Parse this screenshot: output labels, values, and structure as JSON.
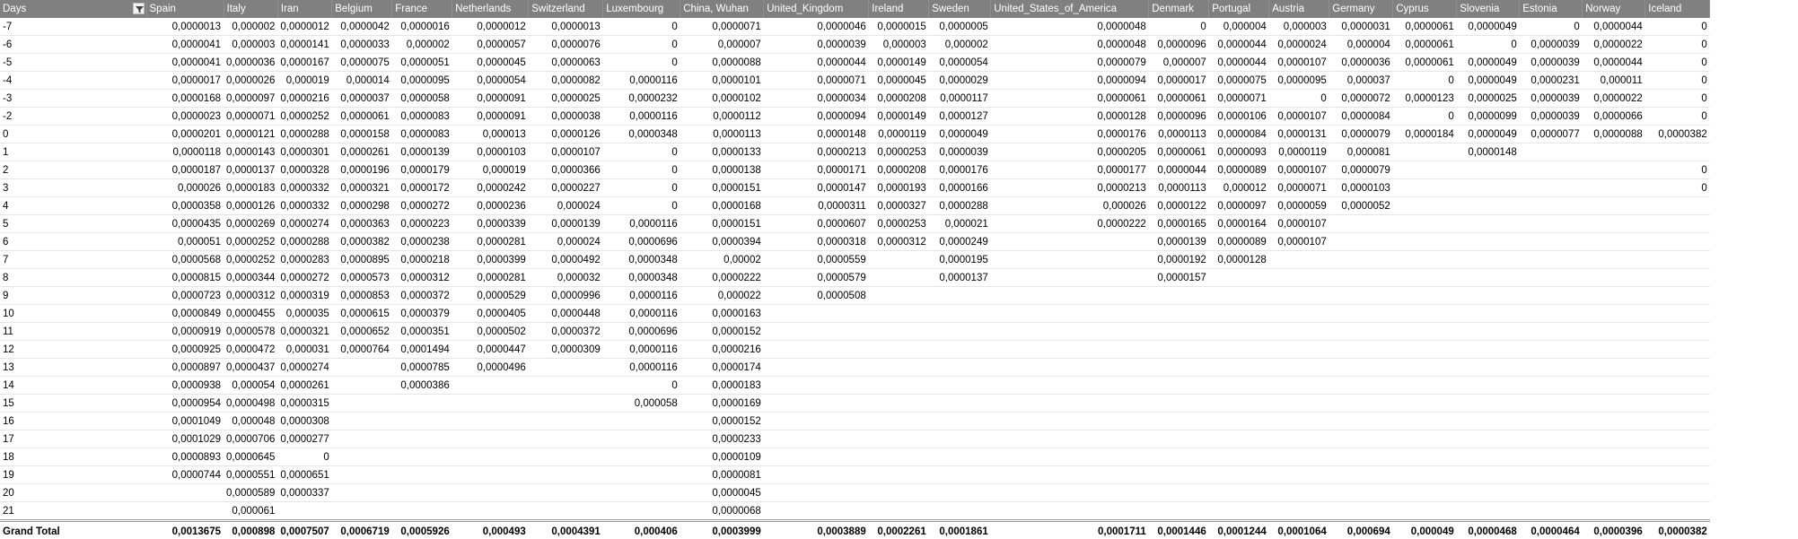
{
  "grid": {
    "row_label_header": "Days",
    "columns": [
      "Spain",
      "Italy",
      "Iran",
      "Belgium",
      "France",
      "Netherlands",
      "Switzerland",
      "Luxembourg",
      "China, Wuhan",
      "United_Kingdom",
      "Ireland",
      "Sweden",
      "United_States_of_America",
      "Denmark",
      "Portugal",
      "Austria",
      "Germany",
      "Cyprus",
      "Slovenia",
      "Estonia",
      "Norway",
      "Iceland"
    ],
    "rows": [
      {
        "day": "-7",
        "v": [
          "0,0000013",
          "0,000002",
          "0,0000012",
          "0,0000042",
          "0,0000016",
          "0,0000012",
          "0,0000013",
          "0",
          "0,0000071",
          "0,0000046",
          "0,0000015",
          "0,0000005",
          "0,0000048",
          "0",
          "0,000004",
          "0,000003",
          "0,0000031",
          "0,0000061",
          "0,0000049",
          "0",
          "0,0000044",
          "0"
        ]
      },
      {
        "day": "-6",
        "v": [
          "0,0000041",
          "0,000003",
          "0,0000141",
          "0,0000033",
          "0,000002",
          "0,0000057",
          "0,0000076",
          "0",
          "0,000007",
          "0,0000039",
          "0,000003",
          "0,000002",
          "0,0000048",
          "0,0000096",
          "0,0000044",
          "0,0000024",
          "0,000004",
          "0,0000061",
          "0",
          "0,0000039",
          "0,0000022",
          "0"
        ]
      },
      {
        "day": "-5",
        "v": [
          "0,0000041",
          "0,0000036",
          "0,0000167",
          "0,0000075",
          "0,0000051",
          "0,0000045",
          "0,0000063",
          "0",
          "0,0000088",
          "0,0000044",
          "0,0000149",
          "0,0000054",
          "0,0000079",
          "0,000007",
          "0,0000044",
          "0,0000107",
          "0,0000036",
          "0,0000061",
          "0,0000049",
          "0,0000039",
          "0,0000044",
          "0"
        ]
      },
      {
        "day": "-4",
        "v": [
          "0,0000017",
          "0,0000026",
          "0,000019",
          "0,000014",
          "0,0000095",
          "0,0000054",
          "0,0000082",
          "0,0000116",
          "0,0000101",
          "0,0000071",
          "0,0000045",
          "0,0000029",
          "0,0000094",
          "0,0000017",
          "0,0000075",
          "0,0000095",
          "0,000037",
          "0",
          "0,0000049",
          "0,0000231",
          "0,000011",
          "0"
        ]
      },
      {
        "day": "-3",
        "v": [
          "0,0000168",
          "0,0000097",
          "0,0000216",
          "0,0000037",
          "0,0000058",
          "0,0000091",
          "0,0000025",
          "0,0000232",
          "0,0000102",
          "0,0000034",
          "0,0000208",
          "0,0000117",
          "0,0000061",
          "0,0000061",
          "0,0000071",
          "0",
          "0,0000072",
          "0,0000123",
          "0,0000025",
          "0,0000039",
          "0,0000022",
          "0"
        ]
      },
      {
        "day": "-2",
        "v": [
          "0,0000023",
          "0,0000071",
          "0,0000252",
          "0,0000061",
          "0,0000083",
          "0,0000091",
          "0,0000038",
          "0,0000116",
          "0,0000112",
          "0,0000094",
          "0,0000149",
          "0,0000127",
          "0,0000128",
          "0,0000096",
          "0,0000106",
          "0,0000107",
          "0,0000084",
          "0",
          "0,0000099",
          "0,0000039",
          "0,0000066",
          "0"
        ]
      },
      {
        "day": "0",
        "v": [
          "0,0000201",
          "0,0000121",
          "0,0000288",
          "0,0000158",
          "0,0000083",
          "0,000013",
          "0,0000126",
          "0,0000348",
          "0,0000113",
          "0,0000148",
          "0,0000119",
          "0,0000049",
          "0,0000176",
          "0,0000113",
          "0,0000084",
          "0,0000131",
          "0,0000079",
          "0,0000184",
          "0,0000049",
          "0,0000077",
          "0,0000088",
          "0,0000382"
        ]
      },
      {
        "day": "1",
        "v": [
          "0,0000118",
          "0,0000143",
          "0,0000301",
          "0,0000261",
          "0,0000139",
          "0,0000103",
          "0,0000107",
          "0",
          "0,0000133",
          "0,0000213",
          "0,0000253",
          "0,0000039",
          "0,0000205",
          "0,0000061",
          "0,0000093",
          "0,0000119",
          "0,000081",
          "",
          "0,0000148",
          "",
          "",
          ""
        ]
      },
      {
        "day": "2",
        "v": [
          "0,0000187",
          "0,0000137",
          "0,0000328",
          "0,0000196",
          "0,0000179",
          "0,000019",
          "0,0000366",
          "0",
          "0,0000138",
          "0,0000171",
          "0,0000208",
          "0,0000176",
          "0,0000177",
          "0,0000044",
          "0,0000089",
          "0,0000107",
          "0,0000079",
          "",
          "",
          "",
          "",
          "0"
        ]
      },
      {
        "day": "3",
        "v": [
          "0,000026",
          "0,0000183",
          "0,0000332",
          "0,0000321",
          "0,0000172",
          "0,0000242",
          "0,0000227",
          "0",
          "0,0000151",
          "0,0000147",
          "0,0000193",
          "0,0000166",
          "0,0000213",
          "0,0000113",
          "0,000012",
          "0,0000071",
          "0,0000103",
          "",
          "",
          "",
          "",
          "0"
        ]
      },
      {
        "day": "4",
        "v": [
          "0,0000358",
          "0,0000126",
          "0,0000332",
          "0,0000298",
          "0,0000272",
          "0,0000236",
          "0,000024",
          "0",
          "0,0000168",
          "0,0000311",
          "0,0000327",
          "0,0000288",
          "0,000026",
          "0,0000122",
          "0,0000097",
          "0,0000059",
          "0,0000052",
          "",
          "",
          "",
          "",
          ""
        ]
      },
      {
        "day": "5",
        "v": [
          "0,0000435",
          "0,0000269",
          "0,0000274",
          "0,0000363",
          "0,0000223",
          "0,0000339",
          "0,0000139",
          "0,0000116",
          "0,0000151",
          "0,0000607",
          "0,0000253",
          "0,000021",
          "0,0000222",
          "0,0000165",
          "0,0000164",
          "0,0000107",
          "",
          "",
          "",
          "",
          "",
          ""
        ]
      },
      {
        "day": "6",
        "v": [
          "0,000051",
          "0,0000252",
          "0,0000288",
          "0,0000382",
          "0,0000238",
          "0,0000281",
          "0,000024",
          "0,0000696",
          "0,0000394",
          "0,0000318",
          "0,0000312",
          "0,0000249",
          "",
          "0,0000139",
          "0,0000089",
          "0,0000107",
          "",
          "",
          "",
          "",
          "",
          ""
        ]
      },
      {
        "day": "7",
        "v": [
          "0,0000568",
          "0,0000252",
          "0,0000283",
          "0,0000895",
          "0,0000218",
          "0,0000399",
          "0,0000492",
          "0,0000348",
          "0,00002",
          "0,0000559",
          "",
          "0,0000195",
          "",
          "0,0000192",
          "0,0000128",
          "",
          "",
          "",
          "",
          "",
          "",
          ""
        ]
      },
      {
        "day": "8",
        "v": [
          "0,0000815",
          "0,0000344",
          "0,0000272",
          "0,0000573",
          "0,0000312",
          "0,0000281",
          "0,000032",
          "0,0000348",
          "0,0000222",
          "0,0000579",
          "",
          "0,0000137",
          "",
          "0,0000157",
          "",
          "",
          "",
          "",
          "",
          "",
          "",
          ""
        ]
      },
      {
        "day": "9",
        "v": [
          "0,0000723",
          "0,0000312",
          "0,0000319",
          "0,0000853",
          "0,0000372",
          "0,0000529",
          "0,0000996",
          "0,0000116",
          "0,000022",
          "0,0000508",
          "",
          "",
          "",
          "",
          "",
          "",
          "",
          "",
          "",
          "",
          "",
          ""
        ]
      },
      {
        "day": "10",
        "v": [
          "0,0000849",
          "0,0000455",
          "0,000035",
          "0,0000615",
          "0,0000379",
          "0,0000405",
          "0,0000448",
          "0,0000116",
          "0,0000163",
          "",
          "",
          "",
          "",
          "",
          "",
          "",
          "",
          "",
          "",
          "",
          "",
          ""
        ]
      },
      {
        "day": "11",
        "v": [
          "0,0000919",
          "0,0000578",
          "0,0000321",
          "0,0000652",
          "0,0000351",
          "0,0000502",
          "0,0000372",
          "0,0000696",
          "0,0000152",
          "",
          "",
          "",
          "",
          "",
          "",
          "",
          "",
          "",
          "",
          "",
          "",
          ""
        ]
      },
      {
        "day": "12",
        "v": [
          "0,0000925",
          "0,0000472",
          "0,000031",
          "0,0000764",
          "0,0001494",
          "0,0000447",
          "0,0000309",
          "0,0000116",
          "0,0000216",
          "",
          "",
          "",
          "",
          "",
          "",
          "",
          "",
          "",
          "",
          "",
          "",
          ""
        ]
      },
      {
        "day": "13",
        "v": [
          "0,0000897",
          "0,0000437",
          "0,0000274",
          "",
          "0,0000785",
          "0,0000496",
          "",
          "0,0000116",
          "0,0000174",
          "",
          "",
          "",
          "",
          "",
          "",
          "",
          "",
          "",
          "",
          "",
          "",
          ""
        ]
      },
      {
        "day": "14",
        "v": [
          "0,0000938",
          "0,000054",
          "0,0000261",
          "",
          "0,0000386",
          "",
          "",
          "0",
          "0,0000183",
          "",
          "",
          "",
          "",
          "",
          "",
          "",
          "",
          "",
          "",
          "",
          "",
          ""
        ]
      },
      {
        "day": "15",
        "v": [
          "0,0000954",
          "0,0000498",
          "0,0000315",
          "",
          "",
          "",
          "",
          "0,000058",
          "0,0000169",
          "",
          "",
          "",
          "",
          "",
          "",
          "",
          "",
          "",
          "",
          "",
          "",
          ""
        ]
      },
      {
        "day": "16",
        "v": [
          "0,0001049",
          "0,000048",
          "0,0000308",
          "",
          "",
          "",
          "",
          "",
          "0,0000152",
          "",
          "",
          "",
          "",
          "",
          "",
          "",
          "",
          "",
          "",
          "",
          "",
          ""
        ]
      },
      {
        "day": "17",
        "v": [
          "0,0001029",
          "0,0000706",
          "0,0000277",
          "",
          "",
          "",
          "",
          "",
          "0,0000233",
          "",
          "",
          "",
          "",
          "",
          "",
          "",
          "",
          "",
          "",
          "",
          "",
          ""
        ]
      },
      {
        "day": "18",
        "v": [
          "0,0000893",
          "0,0000645",
          "0",
          "",
          "",
          "",
          "",
          "",
          "0,0000109",
          "",
          "",
          "",
          "",
          "",
          "",
          "",
          "",
          "",
          "",
          "",
          "",
          ""
        ]
      },
      {
        "day": "19",
        "v": [
          "0,0000744",
          "0,0000551",
          "0,0000651",
          "",
          "",
          "",
          "",
          "",
          "0,0000081",
          "",
          "",
          "",
          "",
          "",
          "",
          "",
          "",
          "",
          "",
          "",
          "",
          ""
        ]
      },
      {
        "day": "20",
        "v": [
          "",
          "0,0000589",
          "0,0000337",
          "",
          "",
          "",
          "",
          "",
          "0,0000045",
          "",
          "",
          "",
          "",
          "",
          "",
          "",
          "",
          "",
          "",
          "",
          "",
          ""
        ]
      },
      {
        "day": "21",
        "v": [
          "",
          "0,000061",
          "",
          "",
          "",
          "",
          "",
          "",
          "0,0000068",
          "",
          "",
          "",
          "",
          "",
          "",
          "",
          "",
          "",
          "",
          "",
          "",
          ""
        ]
      }
    ],
    "total": {
      "label": "Grand Total",
      "v": [
        "0,0013675",
        "0,000898",
        "0,0007507",
        "0,0006719",
        "0,0005926",
        "0,000493",
        "0,0004391",
        "0,000406",
        "0,0003999",
        "0,0003889",
        "0,0002261",
        "0,0001861",
        "0,0001711",
        "0,0001446",
        "0,0001244",
        "0,0001064",
        "0,000694",
        "0,000049",
        "0,0000468",
        "0,0000464",
        "0,0000396",
        "0,0000382"
      ]
    },
    "icons": {
      "filter": "filter-dropdown-icon"
    },
    "colors": {
      "header_bg": "#808080",
      "header_text": "#ffffff"
    }
  }
}
